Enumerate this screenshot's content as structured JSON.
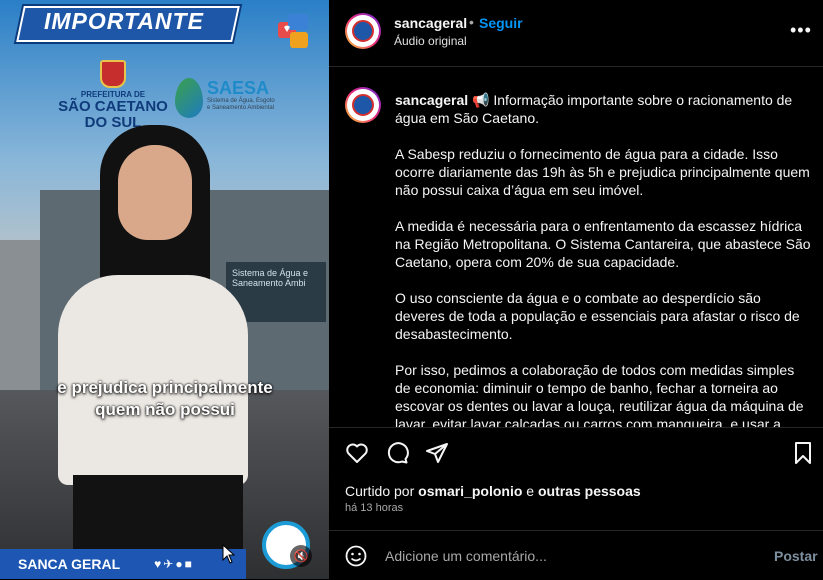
{
  "video": {
    "banner": "IMPORTANTE",
    "prefeitura_line1": "PREFEITURA DE",
    "prefeitura_line2": "SÃO CAETANO",
    "prefeitura_line3": "DO SUL",
    "saesa_name": "SAESA",
    "saesa_sub": "Sistema de Água, Esgoto e Saneamento Ambiental",
    "building_sign": "Sistema de Água e Saneamento Ambi",
    "caption_line1": "e prejudica principalmente",
    "caption_line2": "quem não possui",
    "footer_brand": "SANCA GERAL",
    "footer_icons": "♥✈●■",
    "mute_icon": "🔇"
  },
  "header": {
    "username": "sancageral",
    "dot": "•",
    "follow": "Seguir",
    "audio": "Áudio original",
    "more": "•••"
  },
  "caption": {
    "username": "sancageral",
    "p1": "📢 Informação importante sobre o racionamento de água em São Caetano.",
    "p2": "A Sabesp reduziu o fornecimento de água para a cidade. Isso ocorre diariamente das 19h às 5h e prejudica principalmente quem não possui caixa d’água em seu imóvel.",
    "p3": "A medida é necessária para o enfrentamento da escassez hídrica na Região Metropolitana. O Sistema Cantareira, que abastece São Caetano, opera com 20% de sua capacidade.",
    "p4": "O uso consciente da água e o combate ao desperdício são deveres de toda a população e essenciais para afastar o risco de desabastecimento.",
    "p5": "Por isso, pedimos a colaboração de todos com medidas simples de economia: diminuir o tempo de banho, fechar a torneira ao escovar os dentes ou lavar a louça, reutilizar água da máquina de lavar, evitar lavar calçadas ou carros com mangueira, e usar a água com"
  },
  "likes": {
    "prefix": "Curtido por",
    "user": "osmari_polonio",
    "mid": "e",
    "others": "outras pessoas"
  },
  "time": "há 13 horas",
  "comment": {
    "placeholder": "Adicione um comentário...",
    "post": "Postar"
  },
  "colors": {
    "accent": "#0095f6",
    "banner": "#1e56a8"
  }
}
